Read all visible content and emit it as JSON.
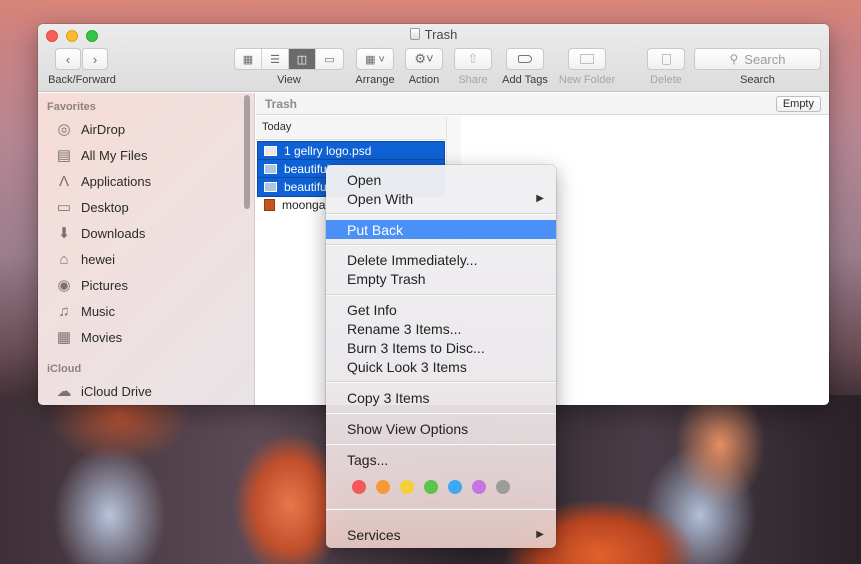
{
  "window": {
    "title": "Trash",
    "title_icon": "trash-icon"
  },
  "toolbar": {
    "back_forward_label": "Back/Forward",
    "view_label": "View",
    "arrange_label": "Arrange",
    "action_label": "Action",
    "share_label": "Share",
    "add_tags_label": "Add Tags",
    "new_folder_label": "New Folder",
    "delete_label": "Delete",
    "search_label": "Search",
    "search_placeholder": "Search",
    "view_modes": [
      "icon-view",
      "list-view",
      "column-view",
      "cover-flow-view"
    ],
    "active_view": "column-view"
  },
  "sidebar": {
    "favorites_header": "Favorites",
    "items": [
      {
        "label": "AirDrop",
        "icon": "airdrop-icon"
      },
      {
        "label": "All My Files",
        "icon": "all-files-icon"
      },
      {
        "label": "Applications",
        "icon": "applications-icon"
      },
      {
        "label": "Desktop",
        "icon": "desktop-icon"
      },
      {
        "label": "Downloads",
        "icon": "downloads-icon"
      },
      {
        "label": "hewei",
        "icon": "home-icon"
      },
      {
        "label": "Pictures",
        "icon": "camera-icon"
      },
      {
        "label": "Music",
        "icon": "music-note-icon"
      },
      {
        "label": "Movies",
        "icon": "film-icon"
      }
    ],
    "icloud_header": "iCloud",
    "icloud_items": [
      {
        "label": "iCloud Drive",
        "icon": "cloud-icon"
      }
    ]
  },
  "main": {
    "path_title": "Trash",
    "empty_button": "Empty",
    "column_header": "Today",
    "files": [
      {
        "name": "1 gellry logo.psd",
        "selected": true
      },
      {
        "name": "beautiful",
        "selected": true
      },
      {
        "name": "beautifu",
        "selected": true
      },
      {
        "name": "moonga",
        "selected": false
      }
    ]
  },
  "context_menu": {
    "groups": [
      [
        {
          "label": "Open"
        },
        {
          "label": "Open With",
          "submenu": true
        }
      ],
      [
        {
          "label": "Put Back",
          "highlighted": true
        }
      ],
      [
        {
          "label": "Delete Immediately..."
        },
        {
          "label": "Empty Trash"
        }
      ],
      [
        {
          "label": "Get Info"
        },
        {
          "label": "Rename 3 Items..."
        },
        {
          "label": "Burn 3 Items to Disc..."
        },
        {
          "label": "Quick Look 3 Items"
        }
      ],
      [
        {
          "label": "Copy 3 Items"
        }
      ],
      [
        {
          "label": "Show View Options"
        }
      ],
      [
        {
          "label": "Tags..."
        }
      ],
      [
        {
          "label": "Services",
          "submenu": true
        }
      ]
    ],
    "tag_colors": [
      {
        "name": "red",
        "color": "#f5575a"
      },
      {
        "name": "orange",
        "color": "#f69a39"
      },
      {
        "name": "yellow",
        "color": "#f5cf38"
      },
      {
        "name": "green",
        "color": "#5ac549"
      },
      {
        "name": "blue",
        "color": "#3fa8f5"
      },
      {
        "name": "purple",
        "color": "#c574e0"
      },
      {
        "name": "gray",
        "color": "#9c9c9c"
      }
    ],
    "submenu_arrow": "▶"
  }
}
